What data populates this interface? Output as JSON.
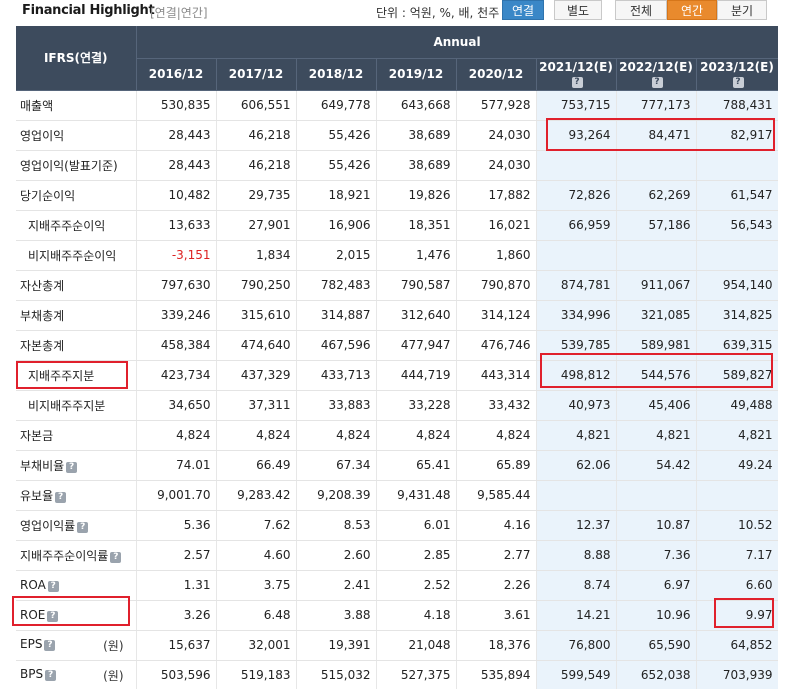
{
  "header": {
    "title": "Financial Highlight",
    "subtitle": "[연결|연간]",
    "units_label": "단위 : 억원, %, 배, 천주",
    "consolidation_buttons": [
      "연결",
      "별도"
    ],
    "period_buttons": [
      "전체",
      "연간",
      "분기"
    ],
    "active_consolidation": "연결",
    "active_period": "연간"
  },
  "table": {
    "corner_label": "IFRS(연결)",
    "group_label": "Annual",
    "columns": [
      "2016/12",
      "2017/12",
      "2018/12",
      "2019/12",
      "2020/12",
      "2021/12(E)",
      "2022/12(E)",
      "2023/12(E)"
    ],
    "estimate_help_icon": "question-icon",
    "rows": [
      {
        "label": "매출액",
        "values": [
          "530,835",
          "606,551",
          "649,778",
          "643,668",
          "577,928",
          "753,715",
          "777,173",
          "788,431"
        ]
      },
      {
        "label": "영업이익",
        "values": [
          "28,443",
          "46,218",
          "55,426",
          "38,689",
          "24,030",
          "93,264",
          "84,471",
          "82,917"
        ]
      },
      {
        "label": "영업이익(발표기준)",
        "values": [
          "28,443",
          "46,218",
          "55,426",
          "38,689",
          "24,030",
          "",
          "",
          ""
        ]
      },
      {
        "label": "당기순이익",
        "values": [
          "10,482",
          "29,735",
          "18,921",
          "19,826",
          "17,882",
          "72,826",
          "62,269",
          "61,547"
        ]
      },
      {
        "label": "지배주주순이익",
        "sub": true,
        "values": [
          "13,633",
          "27,901",
          "16,906",
          "18,351",
          "16,021",
          "66,959",
          "57,186",
          "56,543"
        ]
      },
      {
        "label": "비지배주주순이익",
        "sub": true,
        "values": [
          "-3,151",
          "1,834",
          "2,015",
          "1,476",
          "1,860",
          "",
          "",
          ""
        ]
      },
      {
        "label": "자산총계",
        "values": [
          "797,630",
          "790,250",
          "782,483",
          "790,587",
          "790,870",
          "874,781",
          "911,067",
          "954,140"
        ]
      },
      {
        "label": "부채총계",
        "values": [
          "339,246",
          "315,610",
          "314,887",
          "312,640",
          "314,124",
          "334,996",
          "321,085",
          "314,825"
        ]
      },
      {
        "label": "자본총계",
        "values": [
          "458,384",
          "474,640",
          "467,596",
          "477,947",
          "476,746",
          "539,785",
          "589,981",
          "639,315"
        ]
      },
      {
        "label": "지배주주지분",
        "sub": true,
        "values": [
          "423,734",
          "437,329",
          "433,713",
          "444,719",
          "443,314",
          "498,812",
          "544,576",
          "589,827"
        ]
      },
      {
        "label": "비지배주주지분",
        "sub": true,
        "values": [
          "34,650",
          "37,311",
          "33,883",
          "33,228",
          "33,432",
          "40,973",
          "45,406",
          "49,488"
        ]
      },
      {
        "label": "자본금",
        "values": [
          "4,824",
          "4,824",
          "4,824",
          "4,824",
          "4,824",
          "4,821",
          "4,821",
          "4,821"
        ]
      },
      {
        "label": "부채비율",
        "help": true,
        "values": [
          "74.01",
          "66.49",
          "67.34",
          "65.41",
          "65.89",
          "62.06",
          "54.42",
          "49.24"
        ]
      },
      {
        "label": "유보율",
        "help": true,
        "values": [
          "9,001.70",
          "9,283.42",
          "9,208.39",
          "9,431.48",
          "9,585.44",
          "",
          "",
          ""
        ]
      },
      {
        "label": "영업이익률",
        "help": true,
        "values": [
          "5.36",
          "7.62",
          "8.53",
          "6.01",
          "4.16",
          "12.37",
          "10.87",
          "10.52"
        ]
      },
      {
        "label": "지배주주순이익률",
        "help": true,
        "values": [
          "2.57",
          "4.60",
          "2.60",
          "2.85",
          "2.77",
          "8.88",
          "7.36",
          "7.17"
        ]
      },
      {
        "label": "ROA",
        "help": true,
        "values": [
          "1.31",
          "3.75",
          "2.41",
          "2.52",
          "2.26",
          "8.74",
          "6.97",
          "6.60"
        ]
      },
      {
        "label": "ROE",
        "help": true,
        "values": [
          "3.26",
          "6.48",
          "3.88",
          "4.18",
          "3.61",
          "14.21",
          "10.96",
          "9.97"
        ]
      },
      {
        "label": "EPS",
        "help": true,
        "unit": "(원)",
        "values": [
          "15,637",
          "32,001",
          "19,391",
          "21,048",
          "18,376",
          "76,800",
          "65,590",
          "64,852"
        ]
      },
      {
        "label": "BPS",
        "help": true,
        "unit": "(원)",
        "values": [
          "503,596",
          "519,183",
          "515,032",
          "527,375",
          "535,894",
          "599,549",
          "652,038",
          "703,939"
        ]
      }
    ]
  },
  "colors": {
    "header_bg": "#3d4b5d",
    "estimate_bg": "#eaf3fb",
    "highlight_box": "#e0202c",
    "negative": "#dd2222",
    "active_consolidation": "#3a87c7",
    "active_period": "#e98a2d"
  }
}
